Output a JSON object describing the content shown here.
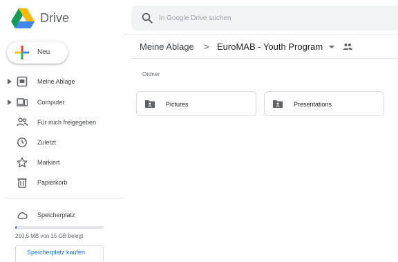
{
  "header": {
    "brand": "Drive",
    "search_placeholder": "In Google Drive suchen"
  },
  "sidebar": {
    "new_label": "Neu",
    "items": [
      {
        "label": "Meine Ablage",
        "icon": "my-drive-icon",
        "expandable": true
      },
      {
        "label": "Computer",
        "icon": "computer-icon",
        "expandable": true
      },
      {
        "label": "Für mich freigegeben",
        "icon": "shared-with-me-icon",
        "expandable": false
      },
      {
        "label": "Zuletzt",
        "icon": "clock-icon",
        "expandable": false
      },
      {
        "label": "Markiert",
        "icon": "star-icon",
        "expandable": false
      },
      {
        "label": "Papierkorb",
        "icon": "trash-icon",
        "expandable": false
      },
      {
        "label": "Speicherplatz",
        "icon": "cloud-icon",
        "expandable": false
      }
    ],
    "storage": {
      "used_text": "210,5 MB von 15 GB belegt",
      "used_fraction": 0.014,
      "buy_label": "Speicherplatz kaufen"
    }
  },
  "main": {
    "breadcrumb": {
      "root": "Meine Ablage",
      "separator": ">",
      "current": "EuroMAB - Youth Program"
    },
    "section_label": "Ordner",
    "folders": [
      {
        "name": "Pictures",
        "icon": "shared-folder-icon"
      },
      {
        "name": "Presentations",
        "icon": "shared-folder-icon"
      }
    ]
  },
  "colors": {
    "accent": "#1a73e8",
    "text": "#3c4043",
    "muted": "#5f6368",
    "search_bg": "#f1f3f4",
    "border": "#dadce0"
  }
}
